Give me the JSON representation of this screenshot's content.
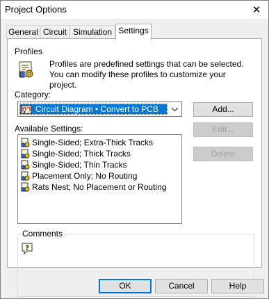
{
  "window": {
    "title": "Project Options",
    "close_glyph": "✕"
  },
  "tabs": [
    {
      "label": "General",
      "active": false
    },
    {
      "label": "Circuit",
      "active": false
    },
    {
      "label": "Simulation",
      "active": false
    },
    {
      "label": "Settings",
      "active": true
    }
  ],
  "profiles": {
    "heading": "Profiles",
    "description": "Profiles are predefined settings that can be selected. You can modify these profiles to customize your project.",
    "icon": "profile-settings-icon"
  },
  "category": {
    "label": "Category:",
    "selected_value": "Circuit Diagram • Convert to PCB",
    "icon": "circuit-diagram-icon"
  },
  "available_settings": {
    "label": "Available Settings:",
    "items": [
      {
        "label": "Single-Sided; Extra-Thick Tracks",
        "icon": "settings-profile-icon"
      },
      {
        "label": "Single-Sided; Thick Tracks",
        "icon": "settings-profile-icon"
      },
      {
        "label": "Single-Sided; Thin Tracks",
        "icon": "settings-profile-icon"
      },
      {
        "label": "Placement Only; No Routing",
        "icon": "settings-profile-icon"
      },
      {
        "label": "Rats Nest; No Placement or Routing",
        "icon": "settings-profile-icon"
      }
    ]
  },
  "side_buttons": {
    "add": "Add...",
    "edit": "Edit...",
    "delete": "Delete"
  },
  "comments": {
    "label": "Comments",
    "icon": "help-question-icon"
  },
  "footer": {
    "ok": "OK",
    "cancel": "Cancel",
    "help": "Help"
  },
  "colors": {
    "selection": "#0078d7",
    "disabled_text": "#a0a0a0",
    "panel": "#ffffff",
    "chrome": "#f0f0f0"
  }
}
